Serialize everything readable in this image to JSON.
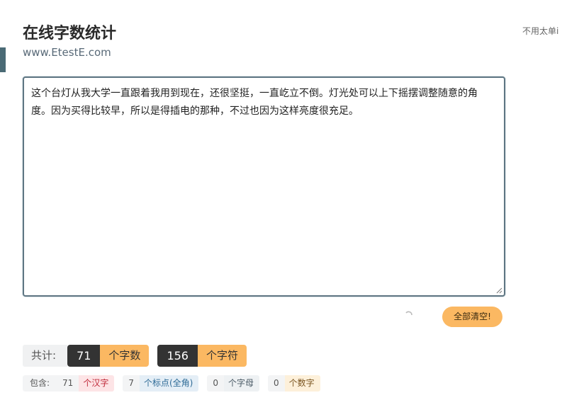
{
  "header": {
    "title": "在线字数统计",
    "subtitle": "www.EtestE.com",
    "side_note": "不用太单i"
  },
  "editor": {
    "text": "这个台灯从我大学一直跟着我用到现在，还很坚挺，一直屹立不倒。灯光处可以上下摇摆调整随意的角度。因为买得比较早，所以是得插电的那种，不过也因为这样亮度很充足。"
  },
  "actions": {
    "clear_label": "全部清空!"
  },
  "totals": {
    "label": "共计:",
    "word_count": "71",
    "word_unit": "个字数",
    "char_count": "156",
    "char_unit": "个字符"
  },
  "breakdown": {
    "label": "包含:",
    "hanzi_count": "71",
    "hanzi_unit": "个汉字",
    "punct_count": "7",
    "punct_unit": "个标点(全角)",
    "letter_count": "0",
    "letter_unit": "个字母",
    "digit_count": "0",
    "digit_unit": "个数字"
  },
  "colors": {
    "accent_orange": "#fbb862",
    "dark": "#333333",
    "border": "#5f7683"
  }
}
